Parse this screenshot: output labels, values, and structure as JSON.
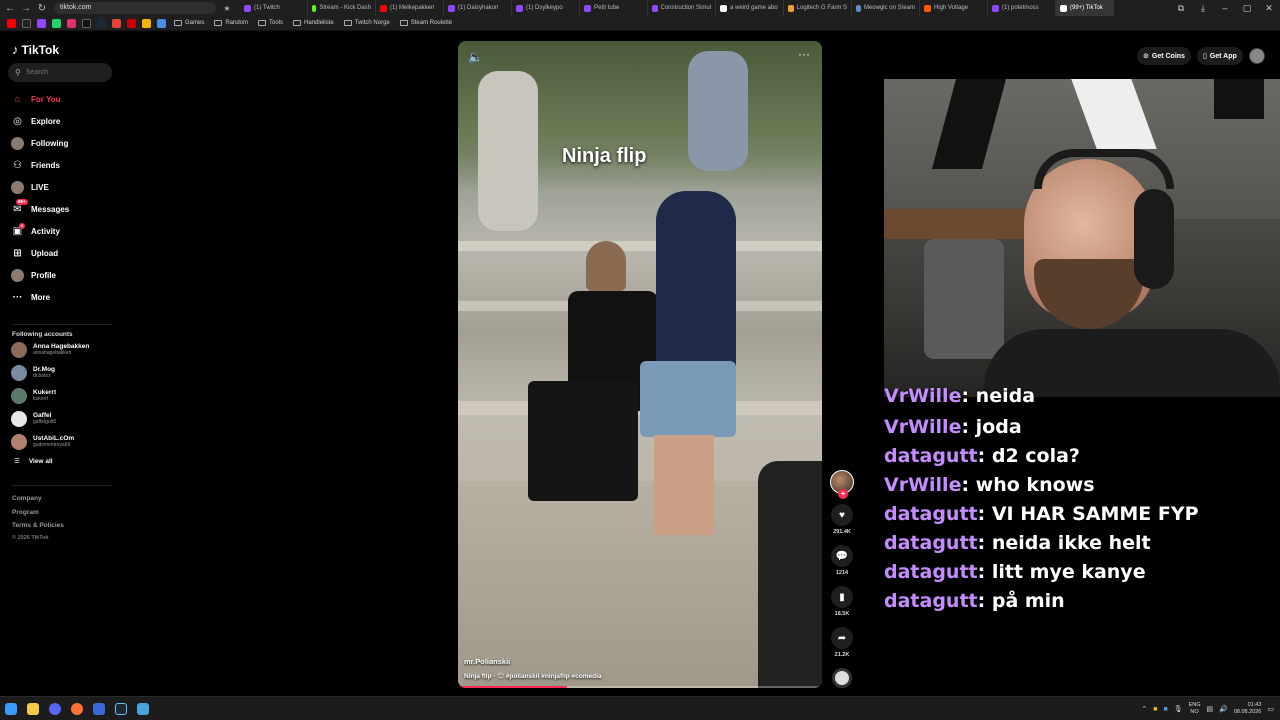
{
  "browser": {
    "url": "tiktok.com",
    "tabs": [
      {
        "label": "(1) Twitch",
        "color": "#9146ff"
      },
      {
        "label": "Stream - Kick Dash",
        "color": "#53fc18"
      },
      {
        "label": "(1) Melkepakken",
        "color": "#ff0000"
      },
      {
        "label": "(1) Daisyhakon",
        "color": "#9146ff"
      },
      {
        "label": "(1) Dsylkeypo",
        "color": "#9146ff"
      },
      {
        "label": "Petit tube",
        "color": "#9146ff"
      },
      {
        "label": "Construction Simul",
        "color": "#9146ff"
      },
      {
        "label": "a weird game abo",
        "color": "#ffffff"
      },
      {
        "label": "Logitech G Farm S",
        "color": "#f0a030"
      },
      {
        "label": "Meowgic on Steam",
        "color": "#5a8dc8"
      },
      {
        "label": "High Voltage",
        "color": "#ff5a00"
      },
      {
        "label": "(1) potetmoss",
        "color": "#9146ff"
      },
      {
        "label": "(99+) TikTok",
        "color": "#ffffff"
      }
    ],
    "bookmarks": [
      "Games",
      "Random",
      "Tools",
      "Handleliste",
      "Twitch Norge",
      "Steam Roulette"
    ]
  },
  "sidebar": {
    "logo": "TikTok",
    "search_placeholder": "Search",
    "nav": [
      {
        "label": "For You",
        "icon": "home-icon",
        "glyph": "⌂"
      },
      {
        "label": "Explore",
        "icon": "compass-icon",
        "glyph": "◎"
      },
      {
        "label": "Following",
        "icon": "following-avatar-icon",
        "glyph": "●"
      },
      {
        "label": "Friends",
        "icon": "friends-icon",
        "glyph": "⚇"
      },
      {
        "label": "LIVE",
        "icon": "live-avatar-icon",
        "glyph": "●"
      },
      {
        "label": "Messages",
        "icon": "messages-icon",
        "glyph": "✉",
        "badge": "99+"
      },
      {
        "label": "Activity",
        "icon": "activity-icon",
        "glyph": "▣",
        "badge": "6"
      },
      {
        "label": "Upload",
        "icon": "upload-icon",
        "glyph": "⊞"
      },
      {
        "label": "Profile",
        "icon": "profile-avatar-icon",
        "glyph": "●"
      },
      {
        "label": "More",
        "icon": "more-icon",
        "glyph": "···"
      }
    ],
    "following_title": "Following accounts",
    "accounts": [
      {
        "name": "Anna Hagebakken",
        "handle": "annahagebakken",
        "color": "#8a6a5a"
      },
      {
        "name": "Dr.Mog",
        "handle": "dr.botox",
        "color": "#7a8aa0"
      },
      {
        "name": "Kukerrt",
        "handle": "kukerrt",
        "color": "#5a7a6a"
      },
      {
        "name": "Gaffel",
        "handle": "gaffelgutt0",
        "color": "#e8e8e8"
      },
      {
        "name": "UstAbiL.cOm",
        "handle": "gudinnentroya69",
        "color": "#b08070"
      }
    ],
    "view_all": "View all",
    "footer": [
      "Company",
      "Program",
      "Terms & Policies"
    ],
    "copyright": "© 2026 TikTok"
  },
  "video": {
    "caption": "Ninja flip",
    "author": "mr.Polianskii",
    "description": "Ninja flip · 😊 #polianskii #ninjaflip #comedia",
    "progress": 0.3
  },
  "actions": {
    "likes": "291.4K",
    "comments": "1214",
    "saves": "18.5K",
    "shares": "21.2K"
  },
  "topbar": {
    "get_coins": "Get Coins",
    "get_app": "Get App"
  },
  "chat": [
    {
      "user": "VrWille",
      "text": ": neida"
    },
    {
      "user": "VrWille",
      "text": ": joda"
    },
    {
      "user": "datagutt",
      "text": ": d2 cola?"
    },
    {
      "user": "VrWille",
      "text": ": who knows"
    },
    {
      "user": "datagutt",
      "text": ": VI HAR SAMME FYP"
    },
    {
      "user": "datagutt",
      "text": ": neida ikke helt"
    },
    {
      "user": "datagutt",
      "text": ": litt mye kanye"
    },
    {
      "user": "datagutt",
      "text": ": på min"
    }
  ],
  "taskbar": {
    "lang": "ENG",
    "region": "NO",
    "time": "01:43",
    "date": "08.08.2026"
  }
}
